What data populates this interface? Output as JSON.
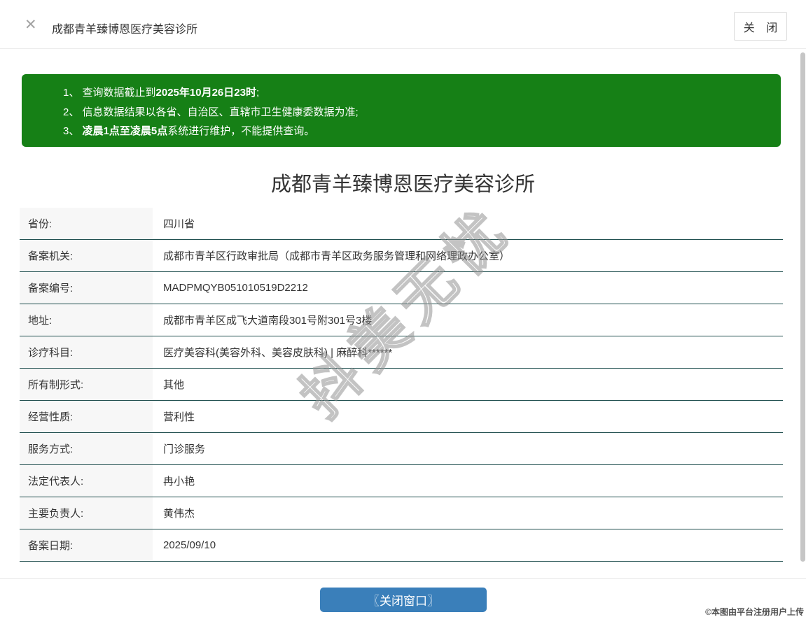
{
  "header": {
    "title": "成都青羊臻博恩医疗美容诊所",
    "close_icon": "✕",
    "close_button_label": "关 闭"
  },
  "notice": {
    "items": [
      {
        "segments": [
          {
            "text": "1、 查询数据截止到",
            "bold": false
          },
          {
            "text": "2025年10月26日23时",
            "bold": true
          },
          {
            "text": ";",
            "bold": false
          }
        ]
      },
      {
        "segments": [
          {
            "text": "2、 信息数据结果以各省、自治区、直辖市卫生健康委数据为准;",
            "bold": false
          }
        ]
      },
      {
        "segments": [
          {
            "text": "3、 ",
            "bold": false
          },
          {
            "text": "凌晨1点至凌晨5点",
            "bold": true
          },
          {
            "text": "系统进行维护，不能提供查询。",
            "bold": false
          }
        ]
      }
    ]
  },
  "main": {
    "title": "成都青羊臻博恩医疗美容诊所",
    "table": {
      "rows": [
        {
          "label": "省份:",
          "value": "四川省"
        },
        {
          "label": "备案机关:",
          "value": "成都市青羊区行政审批局（成都市青羊区政务服务管理和网络理政办公室）"
        },
        {
          "label": "备案编号:",
          "value": "MADPMQYB051010519D2212"
        },
        {
          "label": "地址:",
          "value": "成都市青羊区成飞大道南段301号附301号3楼"
        },
        {
          "label": "诊疗科目:",
          "value": "医疗美容科(美容外科、美容皮肤科) | 麻醉科******"
        },
        {
          "label": "所有制形式:",
          "value": "其他"
        },
        {
          "label": "经营性质:",
          "value": "营利性"
        },
        {
          "label": "服务方式:",
          "value": "门诊服务"
        },
        {
          "label": "法定代表人:",
          "value": "冉小艳"
        },
        {
          "label": "主要负责人:",
          "value": "黄伟杰"
        },
        {
          "label": "备案日期:",
          "value": "2025/09/10"
        }
      ]
    }
  },
  "footer": {
    "close_window_button_label": "〖关闭窗口〗",
    "copyright": "©本图由平台注册用户上传"
  },
  "watermark": {
    "text": "抖美无忧"
  },
  "colors": {
    "notice_green": "#168016",
    "button_blue": "#3a7fba",
    "row_separator": "#1f4e4e",
    "label_bg": "#f7f7f7"
  }
}
